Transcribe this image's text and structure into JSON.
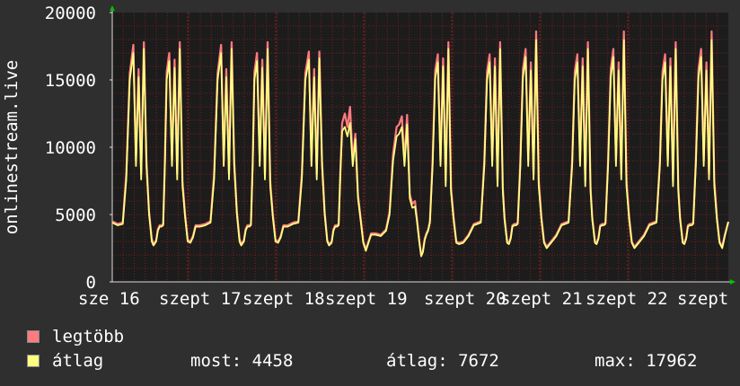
{
  "chart_data": {
    "type": "line",
    "title": "",
    "ylabel": "onlinestream.live",
    "xlabel": "",
    "ylim": [
      0,
      20000
    ],
    "y_ticks": [
      0,
      5000,
      10000,
      15000,
      20000
    ],
    "x_tick_labels": [
      "sze 16",
      "szept 17",
      "szept 18",
      "szept 19",
      "szept 20",
      "szept 21",
      "szept 22",
      "szept"
    ],
    "grid": true,
    "legend_placement": "bottom-left",
    "colors": {
      "max": "#ff7b80",
      "avg": "#ffff80",
      "background": "#2f2f2f",
      "plot": "#1c1c1c",
      "grid": "#7a1e1e"
    },
    "x_days": [
      0,
      0.06,
      0.12,
      0.16,
      0.2,
      0.24,
      0.27,
      0.3,
      0.33,
      0.36,
      0.39,
      0.42,
      0.45,
      0.47,
      0.5,
      0.52,
      0.54,
      0.56,
      0.58,
      0.6,
      0.62,
      0.65,
      0.68,
      0.71,
      0.74,
      0.77,
      0.8,
      0.83,
      0.86,
      0.89,
      0.92,
      0.95,
      1,
      1.06,
      1.12,
      1.16,
      1.2,
      1.24,
      1.27,
      1.3,
      1.33,
      1.36,
      1.39,
      1.42,
      1.45,
      1.47,
      1.5,
      1.52,
      1.54,
      1.56,
      1.58,
      1.6,
      1.62,
      1.65,
      1.68,
      1.71,
      1.74,
      1.77,
      1.8,
      1.83,
      1.86,
      1.89,
      1.92,
      1.95,
      2,
      2.06,
      2.12,
      2.16,
      2.2,
      2.24,
      2.27,
      2.3,
      2.33,
      2.36,
      2.39,
      2.42,
      2.45,
      2.47,
      2.5,
      2.52,
      2.54,
      2.56,
      2.58,
      2.6,
      2.62,
      2.65,
      2.68,
      2.71,
      2.74,
      2.77,
      2.8,
      2.83,
      2.86,
      2.89,
      2.92,
      2.95,
      3,
      3.06,
      3.12,
      3.16,
      3.2,
      3.24,
      3.27,
      3.3,
      3.33,
      3.36,
      3.39,
      3.42,
      3.45,
      3.47,
      3.5,
      3.52,
      3.54,
      3.56,
      3.58,
      3.6,
      3.62,
      3.65,
      3.68,
      3.71,
      3.74,
      3.77,
      3.8,
      3.83,
      3.86,
      3.89,
      3.92,
      3.95,
      4,
      4.06,
      4.12,
      4.16,
      4.2,
      4.24,
      4.27,
      4.3,
      4.33,
      4.36,
      4.39,
      4.42,
      4.45,
      4.47,
      4.5,
      4.52,
      4.54,
      4.56,
      4.58,
      4.6,
      4.62,
      4.65,
      4.68,
      4.71,
      4.74,
      4.77,
      4.8,
      4.83,
      4.86,
      4.89,
      4.92,
      4.95,
      5,
      5.06,
      5.12,
      5.16,
      5.2,
      5.24,
      5.27,
      5.3,
      5.33,
      5.36,
      5.39,
      5.42,
      5.45,
      5.47,
      5.5,
      5.52,
      5.54,
      5.56,
      5.58,
      5.6,
      5.62,
      5.65,
      5.68,
      5.71,
      5.74,
      5.77,
      5.8,
      5.83,
      5.86,
      5.89,
      5.92,
      5.95,
      6,
      6.06,
      6.12,
      6.16,
      6.2,
      6.24,
      6.27,
      6.3,
      6.33,
      6.36,
      6.39,
      6.42,
      6.45,
      6.47,
      6.5,
      6.52,
      6.54,
      6.56,
      6.58,
      6.6,
      6.62,
      6.65,
      6.68,
      6.71,
      6.74,
      6.77,
      6.8,
      6.83,
      6.86,
      6.89,
      6.92,
      6.95,
      6.98,
      7.02
    ],
    "series": [
      {
        "name": "legtöbb",
        "values": [
          4500,
          4300,
          4400,
          8000,
          15500,
          17600,
          9000,
          15800,
          8000,
          17800,
          9000,
          5200,
          3200,
          2800,
          3100,
          3900,
          4200,
          4200,
          4300,
          9000,
          15600,
          17000,
          9000,
          16500,
          8000,
          17800,
          7500,
          5000,
          3100,
          3000,
          3400,
          4200,
          4200,
          4300,
          4500,
          8000,
          15500,
          17600,
          9000,
          15800,
          8000,
          17800,
          9000,
          5200,
          3200,
          2800,
          3100,
          3900,
          4200,
          4200,
          4300,
          9000,
          15600,
          17000,
          9000,
          16500,
          8000,
          17800,
          7500,
          5000,
          3100,
          3000,
          3400,
          4200,
          4200,
          4400,
          4500,
          8000,
          15500,
          17100,
          9000,
          15800,
          8000,
          17100,
          9000,
          5200,
          3100,
          2800,
          3000,
          3900,
          4200,
          4200,
          4300,
          8500,
          11800,
          12500,
          11500,
          13000,
          9000,
          11000,
          6500,
          4800,
          3000,
          2400,
          3000,
          3600,
          3600,
          3500,
          3900,
          5200,
          9500,
          11500,
          11700,
          12300,
          9000,
          12400,
          6500,
          5800,
          6000,
          4800,
          3000,
          2000,
          2300,
          3200,
          3600,
          3900,
          4500,
          9000,
          15700,
          16900,
          9000,
          16600,
          7500,
          17800,
          7000,
          4800,
          3000,
          2900,
          3000,
          3500,
          4300,
          4400,
          4500,
          9000,
          15600,
          16900,
          9000,
          16600,
          7500,
          17800,
          7000,
          4800,
          3000,
          2900,
          3300,
          4200,
          4300,
          4300,
          4400,
          9000,
          15800,
          17300,
          9000,
          16300,
          8000,
          18600,
          7500,
          4800,
          3000,
          2600,
          3000,
          3500,
          4300,
          4400,
          4500,
          9000,
          15600,
          16900,
          9000,
          16600,
          7500,
          17800,
          7000,
          4800,
          3000,
          2900,
          3300,
          4200,
          4300,
          4300,
          4400,
          9000,
          15800,
          17300,
          9000,
          16300,
          8000,
          18600,
          7500,
          4800,
          3000,
          2600,
          3000,
          3500,
          4300,
          4400,
          4500,
          9000,
          15600,
          16900,
          9000,
          16600,
          7500,
          17800,
          7000,
          4800,
          3000,
          2900,
          3300,
          4200,
          4300,
          4300,
          4400,
          9000,
          15800,
          17300,
          9000,
          16300,
          8000,
          18600,
          7500,
          4800,
          3000,
          2600,
          3500,
          4458
        ]
      },
      {
        "name": "átlag",
        "values": [
          4400,
          4200,
          4300,
          7600,
          15000,
          17000,
          8600,
          15200,
          7600,
          17300,
          8600,
          5000,
          3000,
          2700,
          3000,
          3800,
          4100,
          4100,
          4200,
          8600,
          15000,
          16400,
          8600,
          15900,
          7600,
          17300,
          7100,
          4800,
          3000,
          2900,
          3300,
          4100,
          4100,
          4200,
          4400,
          7600,
          15000,
          17000,
          8600,
          15200,
          7600,
          17300,
          8600,
          5000,
          3000,
          2700,
          3000,
          3800,
          4100,
          4100,
          4200,
          8600,
          15000,
          16400,
          8600,
          15900,
          7600,
          17300,
          7100,
          4800,
          3000,
          2900,
          3300,
          4100,
          4100,
          4300,
          4400,
          7600,
          15000,
          16500,
          8600,
          15200,
          7600,
          16600,
          8600,
          5000,
          3000,
          2700,
          2900,
          3800,
          4100,
          4100,
          4200,
          8100,
          11200,
          11500,
          10800,
          11800,
          8600,
          10600,
          6200,
          4600,
          2900,
          2300,
          2900,
          3500,
          3500,
          3400,
          3800,
          5000,
          9000,
          10800,
          11000,
          11500,
          8600,
          11700,
          6200,
          5500,
          5600,
          4600,
          2900,
          1900,
          2200,
          3100,
          3500,
          3800,
          4400,
          8600,
          15100,
          16300,
          8600,
          16000,
          7100,
          17300,
          6700,
          4600,
          2900,
          2800,
          2900,
          3400,
          4200,
          4300,
          4400,
          8600,
          15000,
          16300,
          8600,
          16000,
          7100,
          17300,
          6700,
          4600,
          2900,
          2800,
          3200,
          4100,
          4200,
          4200,
          4300,
          8600,
          15200,
          16700,
          8600,
          15700,
          7600,
          17962,
          7100,
          4600,
          2900,
          2500,
          2900,
          3400,
          4200,
          4300,
          4400,
          8600,
          15000,
          16300,
          8600,
          16000,
          7100,
          17300,
          6700,
          4600,
          2900,
          2800,
          3200,
          4100,
          4200,
          4200,
          4300,
          8600,
          15200,
          16700,
          8600,
          15700,
          7600,
          17962,
          7100,
          4600,
          2900,
          2500,
          2900,
          3400,
          4200,
          4300,
          4400,
          8600,
          15000,
          16300,
          8600,
          16000,
          7100,
          17300,
          6700,
          4600,
          2900,
          2800,
          3200,
          4100,
          4200,
          4200,
          4300,
          8600,
          15200,
          16700,
          8600,
          15700,
          7600,
          17962,
          7100,
          4600,
          2900,
          2500,
          3400,
          4458
        ]
      }
    ]
  },
  "legend": [
    {
      "label": "legtöbb",
      "color": "#ff7b80"
    },
    {
      "label": "átlag",
      "color": "#ffff80"
    }
  ],
  "stats": {
    "now": "most: 4458",
    "avg": "átlag: 7672",
    "max": "max: 17962"
  }
}
